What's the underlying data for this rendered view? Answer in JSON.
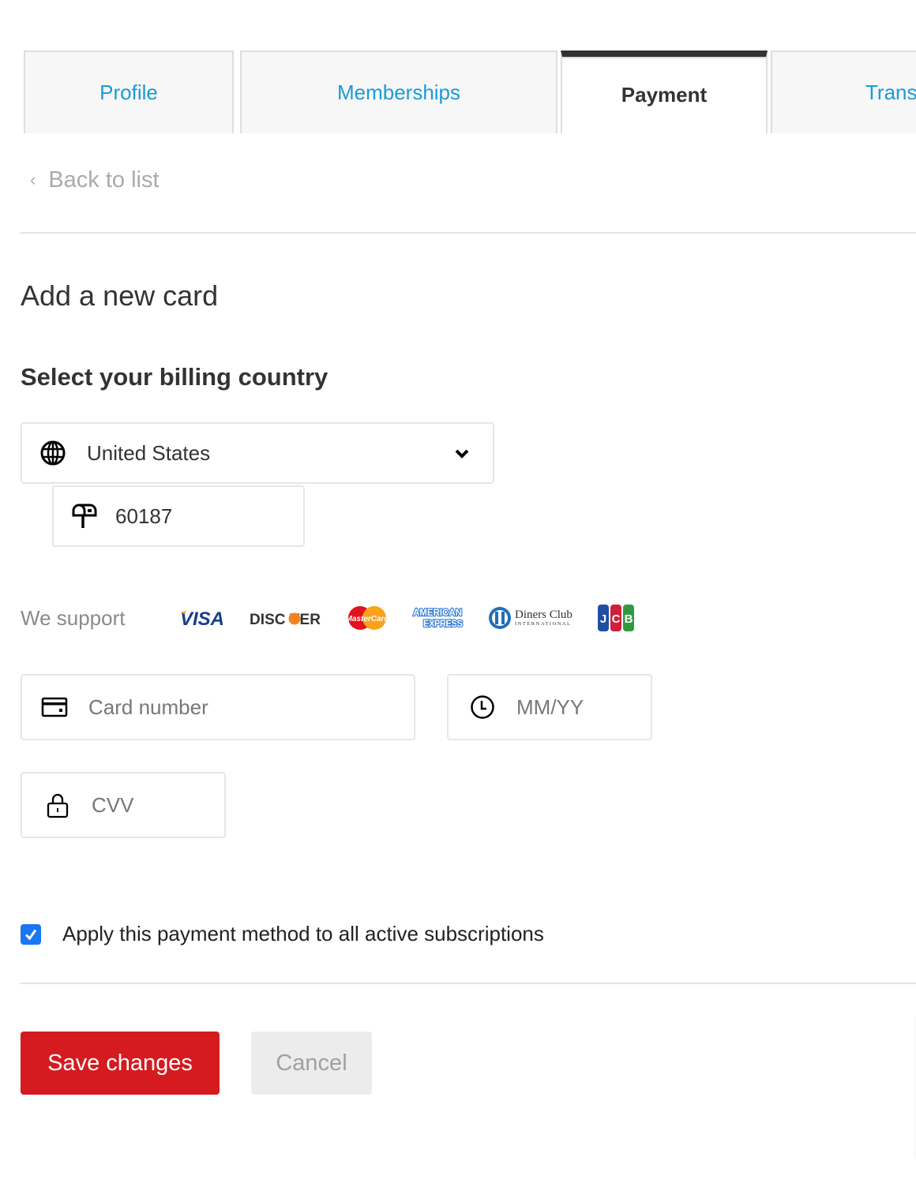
{
  "tabs": [
    {
      "label": "Profile",
      "active": false
    },
    {
      "label": "Memberships",
      "active": false
    },
    {
      "label": "Payment",
      "active": true
    },
    {
      "label": "Trans",
      "active": false
    }
  ],
  "back_link": {
    "label": "Back to list",
    "icon": "chevron-left-icon"
  },
  "heading": "Add a new card",
  "billing": {
    "heading": "Select your billing country",
    "country": {
      "value": "United States",
      "icon": "globe-icon"
    },
    "zip": {
      "value": "60187",
      "icon": "mailbox-icon"
    }
  },
  "supported": {
    "label": "We support",
    "brands": [
      "VISA",
      "DISCOVER",
      "MasterCard",
      "American Express",
      "Diners Club International",
      "JCB"
    ]
  },
  "card_fields": {
    "card_number": {
      "placeholder": "Card number",
      "icon": "credit-card-icon"
    },
    "expiry": {
      "placeholder": "MM/YY",
      "icon": "clock-icon"
    },
    "cvv": {
      "placeholder": "CVV",
      "icon": "lock-icon"
    }
  },
  "apply_all": {
    "label": "Apply this payment method to all active subscriptions",
    "checked": true
  },
  "actions": {
    "save": "Save changes",
    "cancel": "Cancel"
  },
  "colors": {
    "link": "#1a9ad6",
    "primary": "#d51b20",
    "checkbox": "#1877f2"
  }
}
